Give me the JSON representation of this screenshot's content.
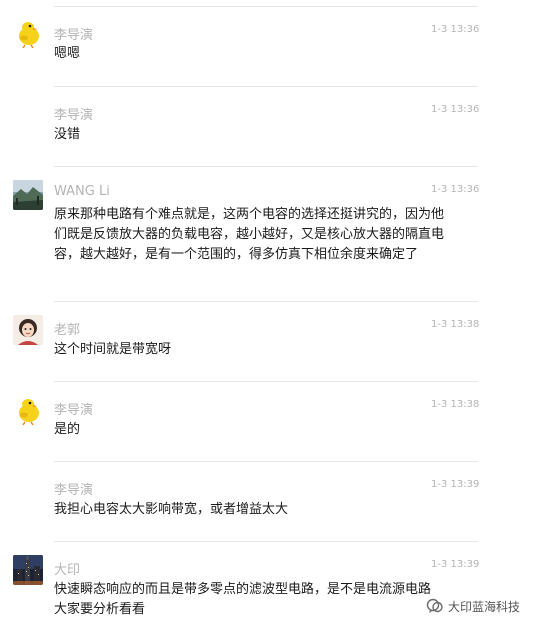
{
  "messages": [
    {
      "name": "李导演",
      "time": "1-3 13:36",
      "text": "嗯嗯",
      "avatar": "chick-avatar"
    },
    {
      "name": "李导演",
      "time": "1-3 13:36",
      "text": "没错",
      "avatar": ""
    },
    {
      "name": "WANG Li",
      "time": "1-3 13:36",
      "text": "原来那种电路有个难点就是，这两个电容的选择还挺讲究的，因为他们既是反馈放大器的负载电容，越小越好，又是核心放大器的隔直电容，越大越好，是有一个范围的，得多仿真下相位余度来确定了",
      "avatar": "landscape-avatar"
    },
    {
      "name": "老郭",
      "time": "1-3 13:38",
      "text": "这个时间就是带宽呀",
      "avatar": "girl-avatar"
    },
    {
      "name": "李导演",
      "time": "1-3 13:38",
      "text": "是的",
      "avatar": "chick-avatar"
    },
    {
      "name": "李导演",
      "time": "1-3 13:39",
      "text": "我担心电容太大影响带宽，或者增益太大",
      "avatar": ""
    },
    {
      "name": "大印",
      "time": "1-3 13:39",
      "text": "快速瞬态响应的而且是带多零点的滤波型电路，是不是电流源电路大家要分析看看",
      "avatar": "city-night-avatar"
    }
  ],
  "watermark": {
    "text": "大印蓝海科技",
    "icon": "wechat-official-account-icon"
  },
  "colors": {
    "meta_text": "#b4b4b4",
    "body_text": "#1a1a1a",
    "divider": "#e6e6e6"
  }
}
